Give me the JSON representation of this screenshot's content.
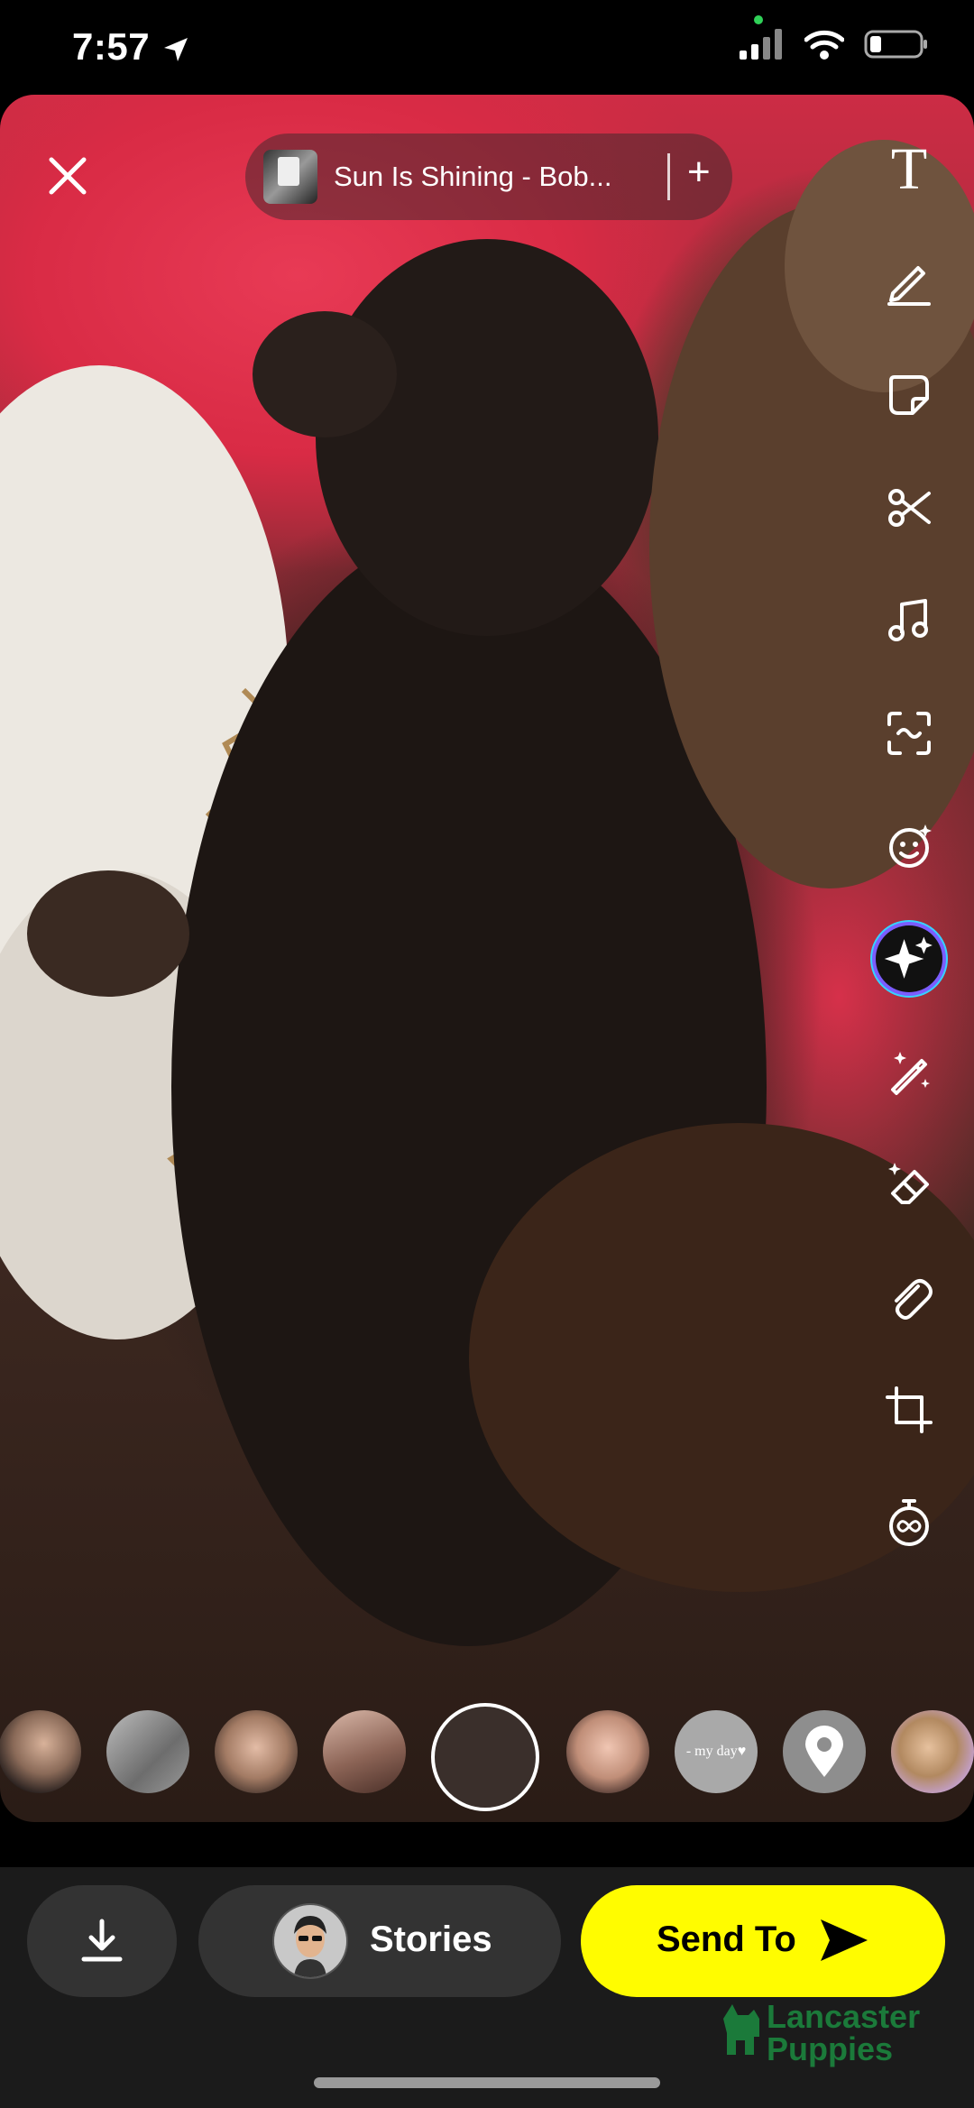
{
  "status": {
    "time": "7:57"
  },
  "music": {
    "title": "Sun Is Shining - Bob...",
    "add_label": "+"
  },
  "toolbar": {
    "text_tool": "T"
  },
  "lenses": {
    "my_day_label": "- my day♥"
  },
  "bottom": {
    "stories_label": "Stories",
    "send_label": "Send To",
    "watermark": "Lancaster Puppies"
  },
  "colors": {
    "send_yellow": "#fffc00",
    "watermark_green": "#1b7a3a",
    "bar_bg": "#1b1b1b"
  }
}
